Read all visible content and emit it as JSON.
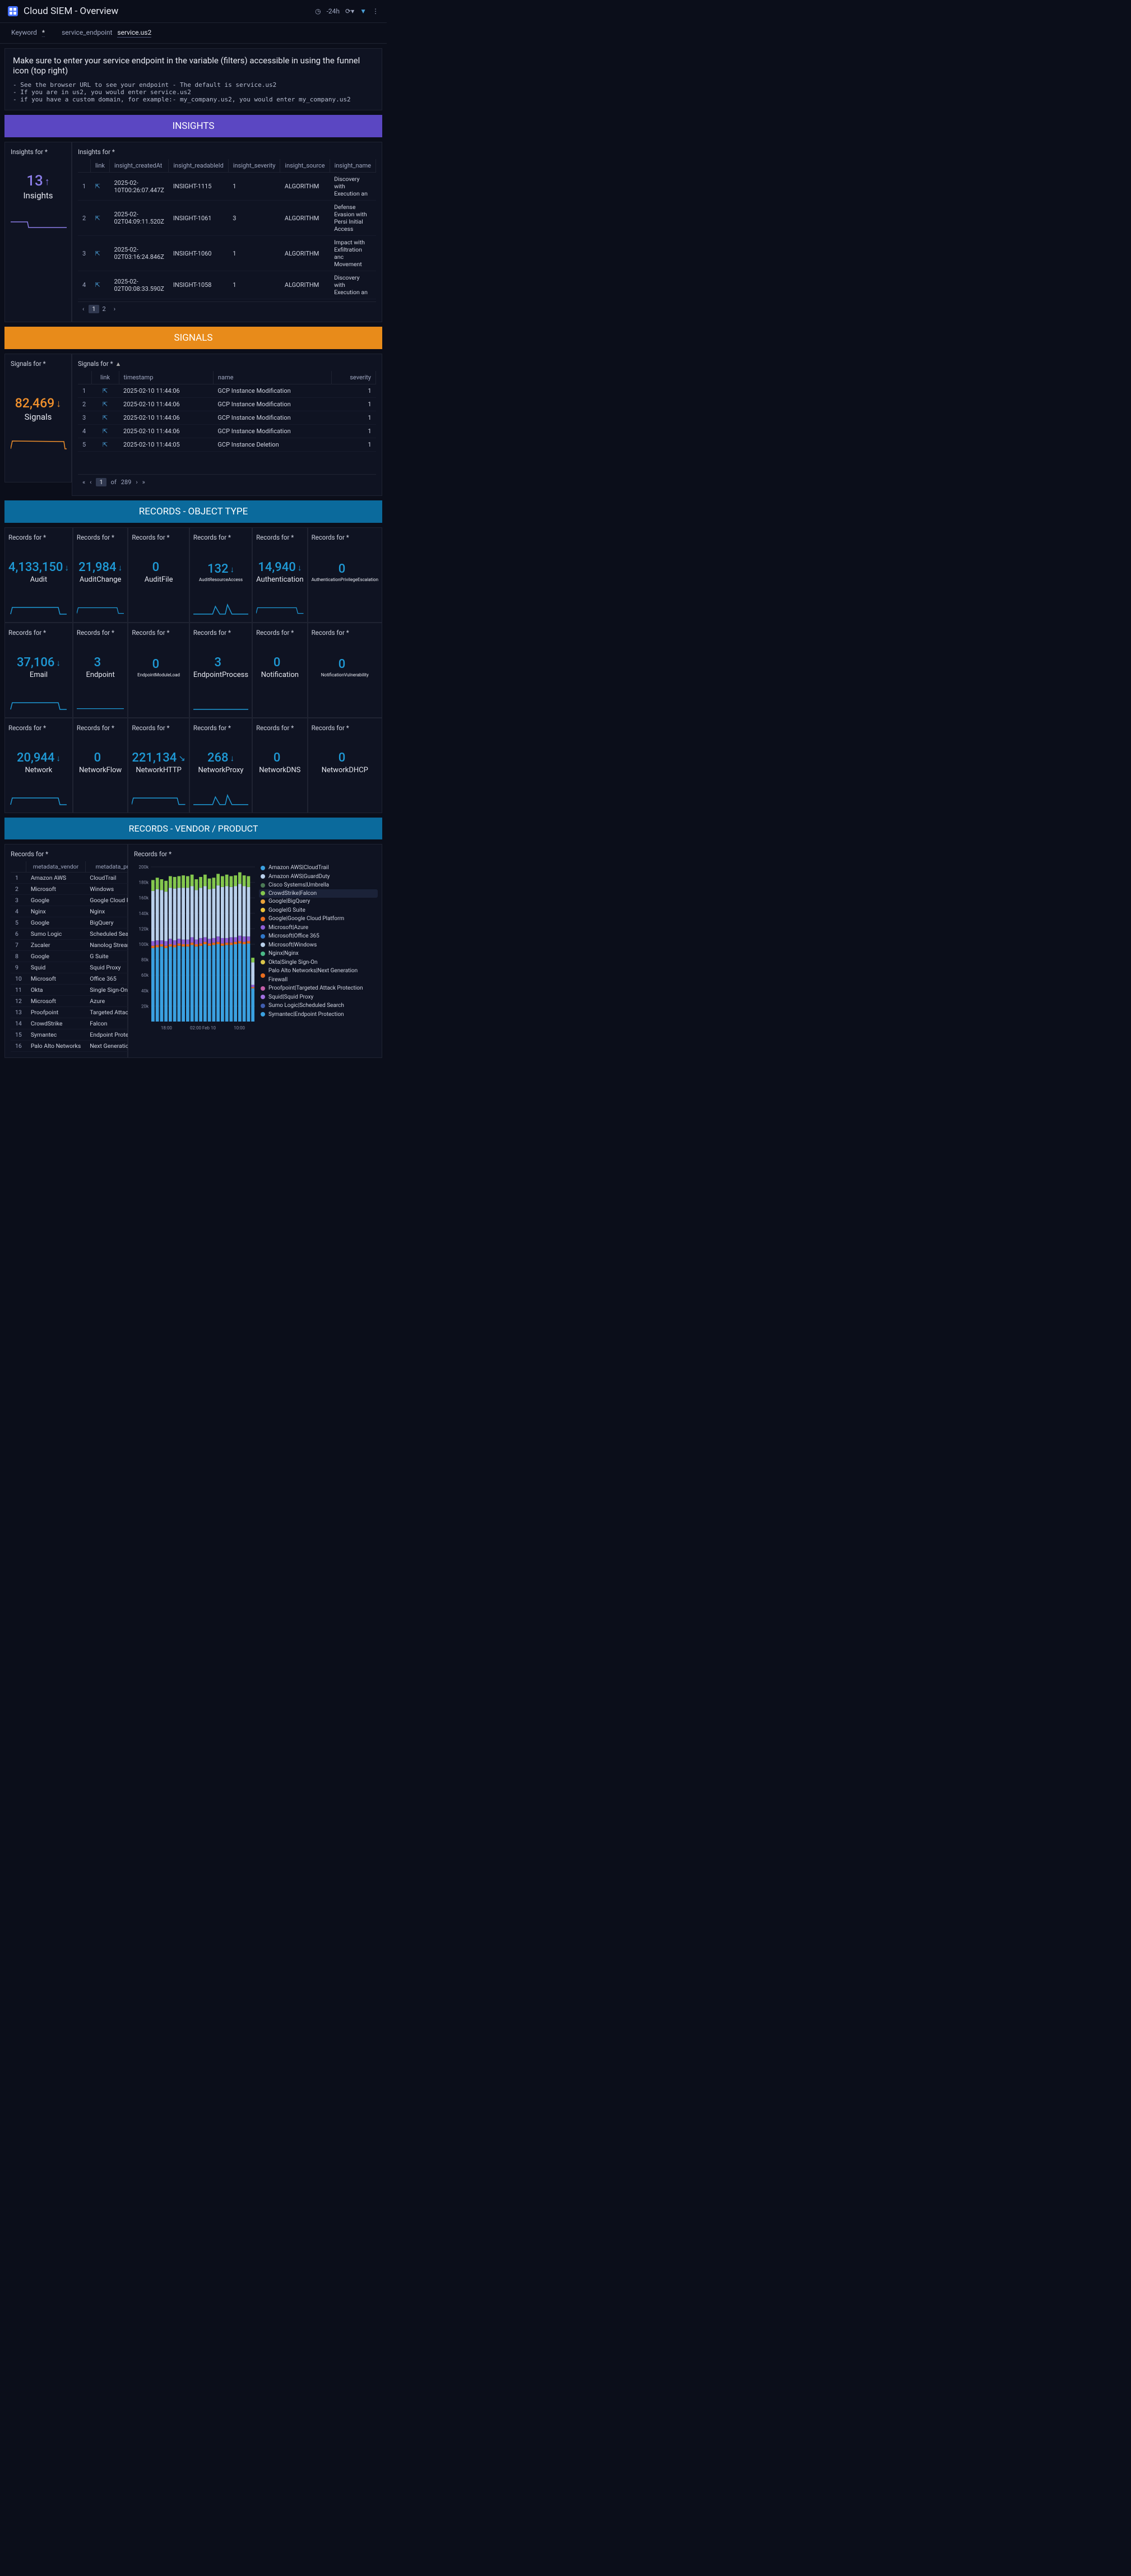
{
  "header": {
    "title": "Cloud SIEM - Overview",
    "time_range": "-24h"
  },
  "filters": {
    "keyword_label": "Keyword",
    "keyword_value": "*",
    "endpoint_label": "service_endpoint",
    "endpoint_value": "service.us2"
  },
  "message": {
    "title": "Make sure to enter your service endpoint in the variable (filters) accessible in using the funnel icon (top right)",
    "lines": [
      "See the browser URL to see your endpoint - The default is service.us2",
      "If you are in us2, you would enter service.us2",
      "if you have a custom domain, for example:-  my_company.us2, you would enter my_company.us2"
    ]
  },
  "banners": {
    "insights": "INSIGHTS",
    "signals": "SIGNALS",
    "records_type": "RECORDS - OBJECT TYPE",
    "records_vendor": "RECORDS - VENDOR / PRODUCT"
  },
  "insights_summary": {
    "title": "Insights for *",
    "value": "13",
    "label": "Insights"
  },
  "insights_table": {
    "title": "Insights for *",
    "columns": [
      "link",
      "insight_createdAt",
      "insight_readableId",
      "insight_severity",
      "insight_source",
      "insight_name"
    ],
    "rows": [
      [
        "1",
        "2025-02-10T00:26:07.447Z",
        "INSIGHT-1115",
        "1",
        "ALGORITHM",
        "Discovery with Execution an"
      ],
      [
        "2",
        "2025-02-02T04:09:11.520Z",
        "INSIGHT-1061",
        "3",
        "ALGORITHM",
        "Defense Evasion with Persi Initial Access"
      ],
      [
        "3",
        "2025-02-02T03:16:24.846Z",
        "INSIGHT-1060",
        "1",
        "ALGORITHM",
        "Impact with Exfiltration anc Movement"
      ],
      [
        "4",
        "2025-02-02T00:08:33.590Z",
        "INSIGHT-1058",
        "1",
        "ALGORITHM",
        "Discovery with Execution an"
      ]
    ],
    "pages": [
      "1",
      "2"
    ]
  },
  "signals_summary": {
    "title": "Signals for *",
    "value": "82,469",
    "label": "Signals"
  },
  "signals_table": {
    "title": "Signals for *",
    "columns": [
      "link",
      "timestamp",
      "name",
      "severity"
    ],
    "rows": [
      [
        "1",
        "2025-02-10 11:44:06",
        "GCP Instance Modification",
        "1"
      ],
      [
        "2",
        "2025-02-10 11:44:06",
        "GCP Instance Modification",
        "1"
      ],
      [
        "3",
        "2025-02-10 11:44:06",
        "GCP Instance Modification",
        "1"
      ],
      [
        "4",
        "2025-02-10 11:44:06",
        "GCP Instance Modification",
        "1"
      ],
      [
        "5",
        "2025-02-10 11:44:05",
        "GCP Instance Deletion",
        "1"
      ]
    ],
    "page_current": "1",
    "page_total": "289",
    "of_label": "of"
  },
  "record_cards": [
    {
      "title": "Records for *",
      "value": "4,133,150",
      "label": "Audit",
      "arrow": "↓",
      "spark": "low-flat",
      "lblcls": "lbl"
    },
    {
      "title": "Records for *",
      "value": "21,984",
      "label": "AuditChange",
      "arrow": "↓",
      "spark": "low-flat",
      "lblcls": "lbl"
    },
    {
      "title": "Records for *",
      "value": "0",
      "label": "AuditFile",
      "arrow": "",
      "spark": "none",
      "lblcls": "lbl"
    },
    {
      "title": "Records for *",
      "value": "132",
      "label": "AuditResourceAccess",
      "arrow": "↓",
      "spark": "bump",
      "lblcls": "lbl-small"
    },
    {
      "title": "Records for *",
      "value": "14,940",
      "label": "Authentication",
      "arrow": "↓",
      "spark": "low-flat",
      "lblcls": "lbl"
    },
    {
      "title": "Records for *",
      "value": "0",
      "label": "AuthenticationPrivilegeEscalation",
      "arrow": "",
      "spark": "none",
      "lblcls": "lbl-small"
    },
    {
      "title": "Records for *",
      "value": "37,106",
      "label": "Email",
      "arrow": "↓",
      "spark": "low-flat",
      "lblcls": "lbl"
    },
    {
      "title": "Records for *",
      "value": "3",
      "label": "Endpoint",
      "arrow": "",
      "spark": "line",
      "lblcls": "lbl"
    },
    {
      "title": "Records for *",
      "value": "0",
      "label": "EndpointModuleLoad",
      "arrow": "",
      "spark": "none",
      "lblcls": "lbl-small"
    },
    {
      "title": "Records for *",
      "value": "3",
      "label": "EndpointProcess",
      "arrow": "",
      "spark": "line",
      "lblcls": "lbl"
    },
    {
      "title": "Records for *",
      "value": "0",
      "label": "Notification",
      "arrow": "",
      "spark": "none",
      "lblcls": "lbl"
    },
    {
      "title": "Records for *",
      "value": "0",
      "label": "NotificationVulnerability",
      "arrow": "",
      "spark": "none",
      "lblcls": "lbl-small"
    },
    {
      "title": "Records for *",
      "value": "20,944",
      "label": "Network",
      "arrow": "↓",
      "spark": "low-flat",
      "lblcls": "lbl"
    },
    {
      "title": "Records for *",
      "value": "0",
      "label": "NetworkFlow",
      "arrow": "",
      "spark": "none",
      "lblcls": "lbl"
    },
    {
      "title": "Records for *",
      "value": "221,134",
      "label": "NetworkHTTP",
      "arrow": "↘",
      "spark": "low-flat",
      "lblcls": "lbl"
    },
    {
      "title": "Records for *",
      "value": "268",
      "label": "NetworkProxy",
      "arrow": "↓",
      "spark": "bump",
      "lblcls": "lbl"
    },
    {
      "title": "Records for *",
      "value": "0",
      "label": "NetworkDNS",
      "arrow": "",
      "spark": "none",
      "lblcls": "lbl"
    },
    {
      "title": "Records for *",
      "value": "0",
      "label": "NetworkDHCP",
      "arrow": "",
      "spark": "none",
      "lblcls": "lbl"
    }
  ],
  "vendor_table": {
    "title": "Records for *",
    "columns": [
      "metadata_vendor",
      "metadata_product"
    ],
    "rows": [
      [
        "1",
        "Amazon AWS",
        "CloudTrail"
      ],
      [
        "2",
        "Microsoft",
        "Windows"
      ],
      [
        "3",
        "Google",
        "Google Cloud Platform"
      ],
      [
        "4",
        "Nginx",
        "Nginx"
      ],
      [
        "5",
        "Google",
        "BigQuery"
      ],
      [
        "6",
        "Sumo Logic",
        "Scheduled Search"
      ],
      [
        "7",
        "Zscaler",
        "Nanolog Streaming Se"
      ],
      [
        "8",
        "Google",
        "G Suite"
      ],
      [
        "9",
        "Squid",
        "Squid Proxy"
      ],
      [
        "10",
        "Microsoft",
        "Office 365"
      ],
      [
        "11",
        "Okta",
        "Single Sign-On"
      ],
      [
        "12",
        "Microsoft",
        "Azure"
      ],
      [
        "13",
        "Proofpoint",
        "Targeted Attack Prote"
      ],
      [
        "14",
        "CrowdStrike",
        "Falcon"
      ],
      [
        "15",
        "Symantec",
        "Endpoint Protection"
      ],
      [
        "16",
        "Palo Alto Networks",
        "Next Generation Firew"
      ]
    ]
  },
  "chart_data": {
    "type": "bar",
    "title": "Records for *",
    "ylim": [
      0,
      200000
    ],
    "yticks": [
      "200k",
      "180k",
      "160k",
      "140k",
      "120k",
      "100k",
      "80k",
      "60k",
      "40k",
      "20k"
    ],
    "xlabels": [
      "18:00",
      "02:00 Feb 10",
      "10:00"
    ],
    "legend": [
      {
        "name": "Amazon AWS|CloudTrail",
        "color": "#3aa0e0"
      },
      {
        "name": "Amazon AWS|GuardDuty",
        "color": "#b9d0eb"
      },
      {
        "name": "Cisco Systems|Umbrella",
        "color": "#4b7a55"
      },
      {
        "name": "CrowdStrike|Falcon",
        "color": "#84c74d",
        "hl": true
      },
      {
        "name": "Google|BigQuery",
        "color": "#e8a23a"
      },
      {
        "name": "Google|G Suite",
        "color": "#e8c23a"
      },
      {
        "name": "Google|Google Cloud Platform",
        "color": "#e86d1f"
      },
      {
        "name": "Microsoft|Azure",
        "color": "#8d5ed6"
      },
      {
        "name": "Microsoft|Office 365",
        "color": "#2f77c9"
      },
      {
        "name": "Microsoft|Windows",
        "color": "#b9d0eb"
      },
      {
        "name": "Nginx|Nginx",
        "color": "#4ab987"
      },
      {
        "name": "Okta|Single Sign-On",
        "color": "#d9c44a"
      },
      {
        "name": "Palo Alto Networks|Next Generation Firewall",
        "color": "#e86d1f"
      },
      {
        "name": "Proofpoint|Targeted Attack Protection",
        "color": "#c25ea8"
      },
      {
        "name": "Squid|Squid Proxy",
        "color": "#a06fe0"
      },
      {
        "name": "Sumo Logic|Scheduled Search",
        "color": "#3f5db0"
      },
      {
        "name": "Symantec|Endpoint Protection",
        "color": "#3aa0e0"
      }
    ],
    "bars": [
      {
        "x": 0,
        "segments": [
          [
            "#3aa0e0",
            95000
          ],
          [
            "#e86d1f",
            3000
          ],
          [
            "#8d5ed6",
            6000
          ],
          [
            "#b9d0eb",
            65000
          ],
          [
            "#84c74d",
            14000
          ]
        ]
      },
      {
        "x": 1,
        "segments": [
          [
            "#3aa0e0",
            96000
          ],
          [
            "#e86d1f",
            3000
          ],
          [
            "#8d5ed6",
            6000
          ],
          [
            "#b9d0eb",
            66000
          ],
          [
            "#84c74d",
            15000
          ]
        ]
      },
      {
        "x": 2,
        "segments": [
          [
            "#3aa0e0",
            97000
          ],
          [
            "#e86d1f",
            3000
          ],
          [
            "#8d5ed6",
            5000
          ],
          [
            "#b9d0eb",
            65000
          ],
          [
            "#84c74d",
            14000
          ]
        ]
      },
      {
        "x": 3,
        "segments": [
          [
            "#3aa0e0",
            95000
          ],
          [
            "#e86d1f",
            3000
          ],
          [
            "#8d5ed6",
            6000
          ],
          [
            "#b9d0eb",
            64000
          ],
          [
            "#84c74d",
            14000
          ]
        ]
      },
      {
        "x": 4,
        "segments": [
          [
            "#3aa0e0",
            97000
          ],
          [
            "#e86d1f",
            3000
          ],
          [
            "#8d5ed6",
            7000
          ],
          [
            "#b9d0eb",
            66000
          ],
          [
            "#84c74d",
            15000
          ]
        ]
      },
      {
        "x": 5,
        "segments": [
          [
            "#3aa0e0",
            96000
          ],
          [
            "#e86d1f",
            3000
          ],
          [
            "#8d5ed6",
            6000
          ],
          [
            "#b9d0eb",
            67000
          ],
          [
            "#84c74d",
            15000
          ]
        ]
      },
      {
        "x": 6,
        "segments": [
          [
            "#3aa0e0",
            98000
          ],
          [
            "#e86d1f",
            3000
          ],
          [
            "#8d5ed6",
            6000
          ],
          [
            "#b9d0eb",
            66000
          ],
          [
            "#84c74d",
            15000
          ]
        ]
      },
      {
        "x": 7,
        "segments": [
          [
            "#3aa0e0",
            97000
          ],
          [
            "#e86d1f",
            3000
          ],
          [
            "#8d5ed6",
            6000
          ],
          [
            "#b9d0eb",
            67000
          ],
          [
            "#84c74d",
            16000
          ]
        ]
      },
      {
        "x": 8,
        "segments": [
          [
            "#3aa0e0",
            97000
          ],
          [
            "#e86d1f",
            3000
          ],
          [
            "#8d5ed6",
            6000
          ],
          [
            "#b9d0eb",
            67000
          ],
          [
            "#84c74d",
            15000
          ]
        ]
      },
      {
        "x": 9,
        "segments": [
          [
            "#3aa0e0",
            99000
          ],
          [
            "#e86d1f",
            3000
          ],
          [
            "#8d5ed6",
            7000
          ],
          [
            "#b9d0eb",
            66000
          ],
          [
            "#84c74d",
            15000
          ]
        ]
      },
      {
        "x": 10,
        "segments": [
          [
            "#3aa0e0",
            97000
          ],
          [
            "#e86d1f",
            3000
          ],
          [
            "#8d5ed6",
            6000
          ],
          [
            "#b9d0eb",
            64000
          ],
          [
            "#84c74d",
            14000
          ]
        ]
      },
      {
        "x": 11,
        "segments": [
          [
            "#3aa0e0",
            98000
          ],
          [
            "#e86d1f",
            3000
          ],
          [
            "#8d5ed6",
            7000
          ],
          [
            "#b9d0eb",
            65000
          ],
          [
            "#84c74d",
            14000
          ]
        ]
      },
      {
        "x": 12,
        "segments": [
          [
            "#3aa0e0",
            100000
          ],
          [
            "#e86d1f",
            3000
          ],
          [
            "#8d5ed6",
            6000
          ],
          [
            "#b9d0eb",
            66000
          ],
          [
            "#84c74d",
            15000
          ]
        ]
      },
      {
        "x": 13,
        "segments": [
          [
            "#3aa0e0",
            98000
          ],
          [
            "#e86d1f",
            3000
          ],
          [
            "#8d5ed6",
            6000
          ],
          [
            "#b9d0eb",
            64000
          ],
          [
            "#84c74d",
            14000
          ]
        ]
      },
      {
        "x": 14,
        "segments": [
          [
            "#3aa0e0",
            99000
          ],
          [
            "#e86d1f",
            3000
          ],
          [
            "#8d5ed6",
            6000
          ],
          [
            "#b9d0eb",
            64000
          ],
          [
            "#84c74d",
            14000
          ]
        ]
      },
      {
        "x": 15,
        "segments": [
          [
            "#3aa0e0",
            100000
          ],
          [
            "#e86d1f",
            3000
          ],
          [
            "#8d5ed6",
            7000
          ],
          [
            "#b9d0eb",
            66000
          ],
          [
            "#84c74d",
            15000
          ]
        ]
      },
      {
        "x": 16,
        "segments": [
          [
            "#3aa0e0",
            98000
          ],
          [
            "#e86d1f",
            3000
          ],
          [
            "#8d5ed6",
            7000
          ],
          [
            "#b9d0eb",
            66000
          ],
          [
            "#84c74d",
            14000
          ]
        ]
      },
      {
        "x": 17,
        "segments": [
          [
            "#3aa0e0",
            99000
          ],
          [
            "#e86d1f",
            3000
          ],
          [
            "#8d5ed6",
            6000
          ],
          [
            "#b9d0eb",
            67000
          ],
          [
            "#84c74d",
            15000
          ]
        ]
      },
      {
        "x": 18,
        "segments": [
          [
            "#3aa0e0",
            99000
          ],
          [
            "#e86d1f",
            3000
          ],
          [
            "#8d5ed6",
            7000
          ],
          [
            "#b9d0eb",
            65000
          ],
          [
            "#84c74d",
            14000
          ]
        ]
      },
      {
        "x": 19,
        "segments": [
          [
            "#3aa0e0",
            100000
          ],
          [
            "#e86d1f",
            3000
          ],
          [
            "#8d5ed6",
            6000
          ],
          [
            "#b9d0eb",
            66000
          ],
          [
            "#84c74d",
            14000
          ]
        ]
      },
      {
        "x": 20,
        "segments": [
          [
            "#3aa0e0",
            101000
          ],
          [
            "#e86d1f",
            3000
          ],
          [
            "#8d5ed6",
            7000
          ],
          [
            "#b9d0eb",
            67000
          ],
          [
            "#84c74d",
            15000
          ]
        ]
      },
      {
        "x": 21,
        "segments": [
          [
            "#3aa0e0",
            100000
          ],
          [
            "#e86d1f",
            3000
          ],
          [
            "#8d5ed6",
            7000
          ],
          [
            "#b9d0eb",
            65000
          ],
          [
            "#84c74d",
            14000
          ]
        ]
      },
      {
        "x": 22,
        "segments": [
          [
            "#3aa0e0",
            101000
          ],
          [
            "#e86d1f",
            3000
          ],
          [
            "#8d5ed6",
            6000
          ],
          [
            "#b9d0eb",
            64000
          ],
          [
            "#84c74d",
            14000
          ]
        ]
      },
      {
        "x": 23,
        "segments": [
          [
            "#3aa0e0",
            43000
          ],
          [
            "#e86d1f",
            1500
          ],
          [
            "#8d5ed6",
            3000
          ],
          [
            "#b9d0eb",
            29000
          ],
          [
            "#84c74d",
            6000
          ]
        ]
      }
    ]
  }
}
